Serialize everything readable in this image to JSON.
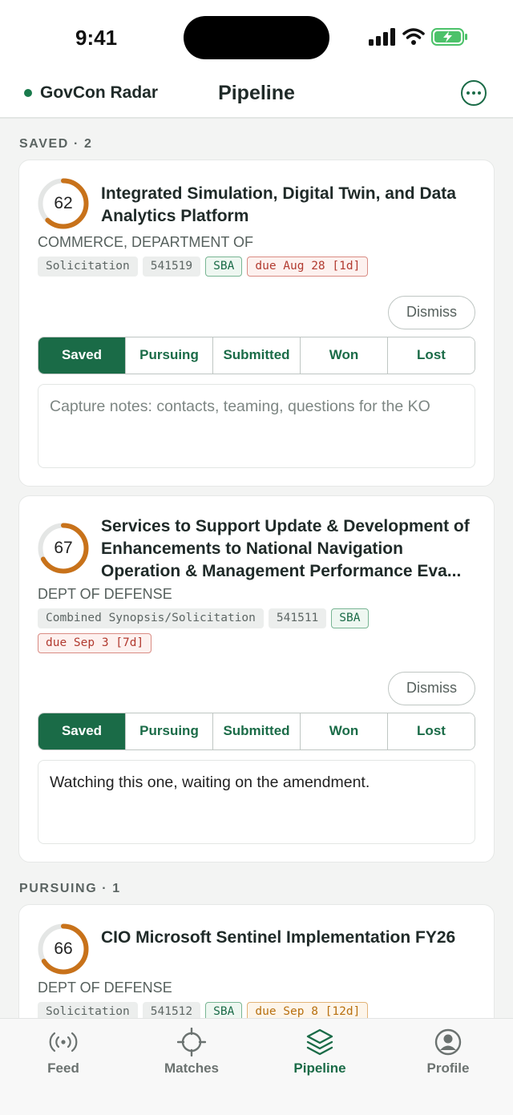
{
  "status_bar": {
    "time": "9:41"
  },
  "header": {
    "brand": "GovCon Radar",
    "title": "Pipeline"
  },
  "sections": [
    {
      "label": "SAVED · 2"
    },
    {
      "label": "PURSUING · 1"
    }
  ],
  "cards": [
    {
      "score": "62",
      "score_fraction": 0.62,
      "title": "Integrated Simulation, Digital Twin, and Data Analytics Platform",
      "agency": "COMMERCE, DEPARTMENT OF",
      "tags": [
        "Solicitation",
        "541519",
        "SBA",
        "due Aug 28 [1d]"
      ],
      "dismiss": "Dismiss",
      "stages": [
        "Saved",
        "Pursuing",
        "Submitted",
        "Won",
        "Lost"
      ],
      "active_stage": "Saved",
      "notes_placeholder": "Capture notes: contacts, teaming, questions for the KO",
      "notes": ""
    },
    {
      "score": "67",
      "score_fraction": 0.67,
      "title": "Services to Support Update & Development of Enhancements to National Navigation Operation & Management Performance Eva...",
      "agency": "DEPT OF DEFENSE",
      "tags": [
        "Combined Synopsis/Solicitation",
        "541511",
        "SBA",
        "due Sep 3 [7d]"
      ],
      "dismiss": "Dismiss",
      "stages": [
        "Saved",
        "Pursuing",
        "Submitted",
        "Won",
        "Lost"
      ],
      "active_stage": "Saved",
      "notes": "Watching this one, waiting on the amendment."
    },
    {
      "score": "66",
      "score_fraction": 0.66,
      "title": "CIO Microsoft Sentinel Implementation FY26",
      "agency": "DEPT OF DEFENSE",
      "tags": [
        "Solicitation",
        "541512",
        "SBA",
        "due Sep 8 [12d]"
      ]
    }
  ],
  "tabbar": {
    "items": [
      {
        "label": "Feed",
        "icon": "broadcast-icon"
      },
      {
        "label": "Matches",
        "icon": "crosshair-icon"
      },
      {
        "label": "Pipeline",
        "icon": "layers-icon",
        "active": true
      },
      {
        "label": "Profile",
        "icon": "user-circle-icon"
      }
    ]
  },
  "colors": {
    "accent": "#1a6b47",
    "score_ring": "#c8721a",
    "due_urgent": "#b23b30",
    "due_warning": "#b8700f"
  }
}
